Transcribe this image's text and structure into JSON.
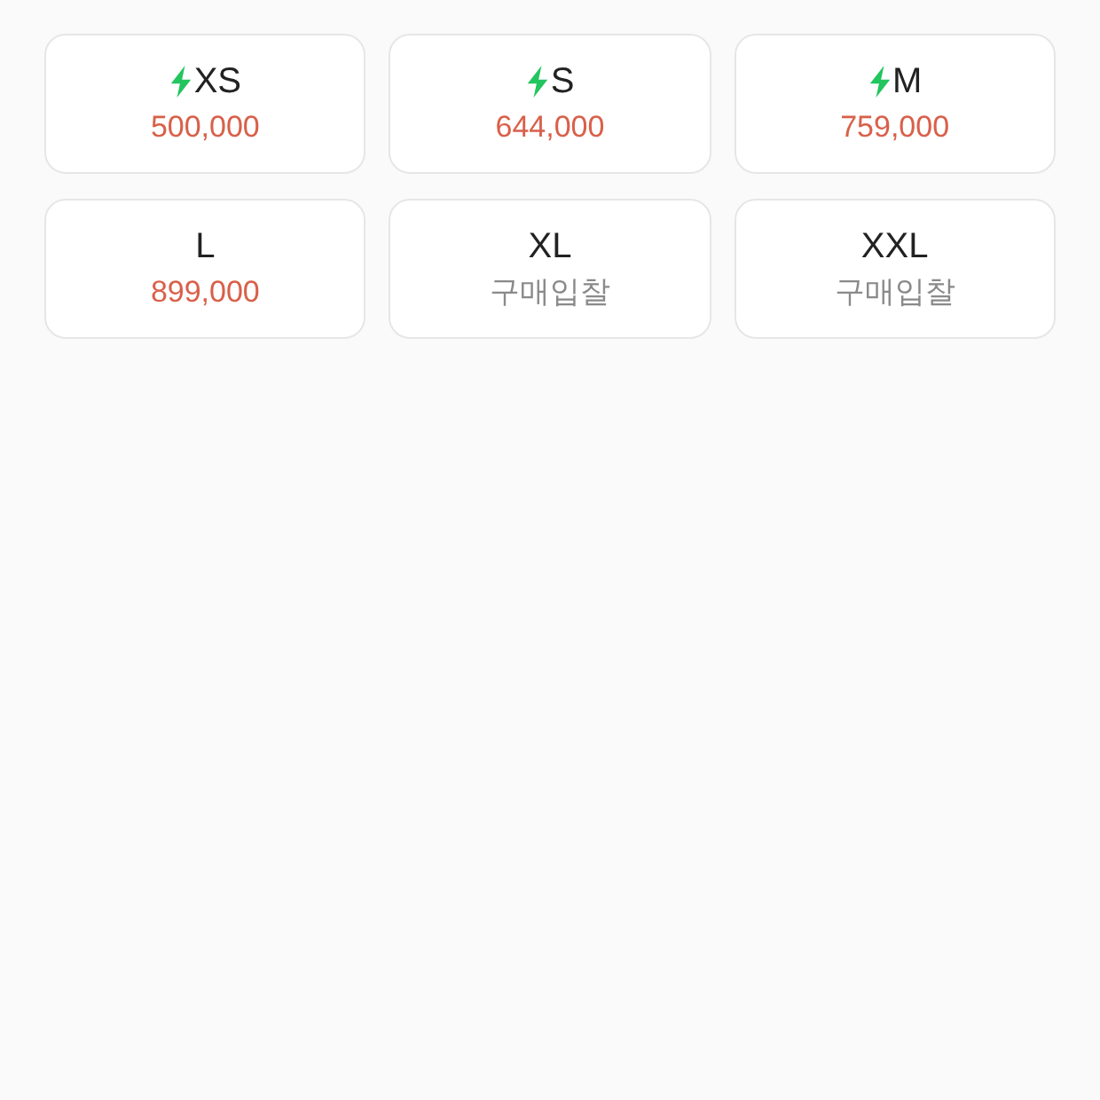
{
  "sizes": [
    {
      "size": "XS",
      "express": true,
      "kind": "price",
      "price": "500,000"
    },
    {
      "size": "S",
      "express": true,
      "kind": "price",
      "price": "644,000"
    },
    {
      "size": "M",
      "express": true,
      "kind": "price",
      "price": "759,000"
    },
    {
      "size": "L",
      "express": false,
      "kind": "price",
      "price": "899,000"
    },
    {
      "size": "XL",
      "express": false,
      "kind": "bid",
      "price": "구매입찰"
    },
    {
      "size": "XXL",
      "express": false,
      "kind": "bid",
      "price": "구매입찰"
    }
  ]
}
